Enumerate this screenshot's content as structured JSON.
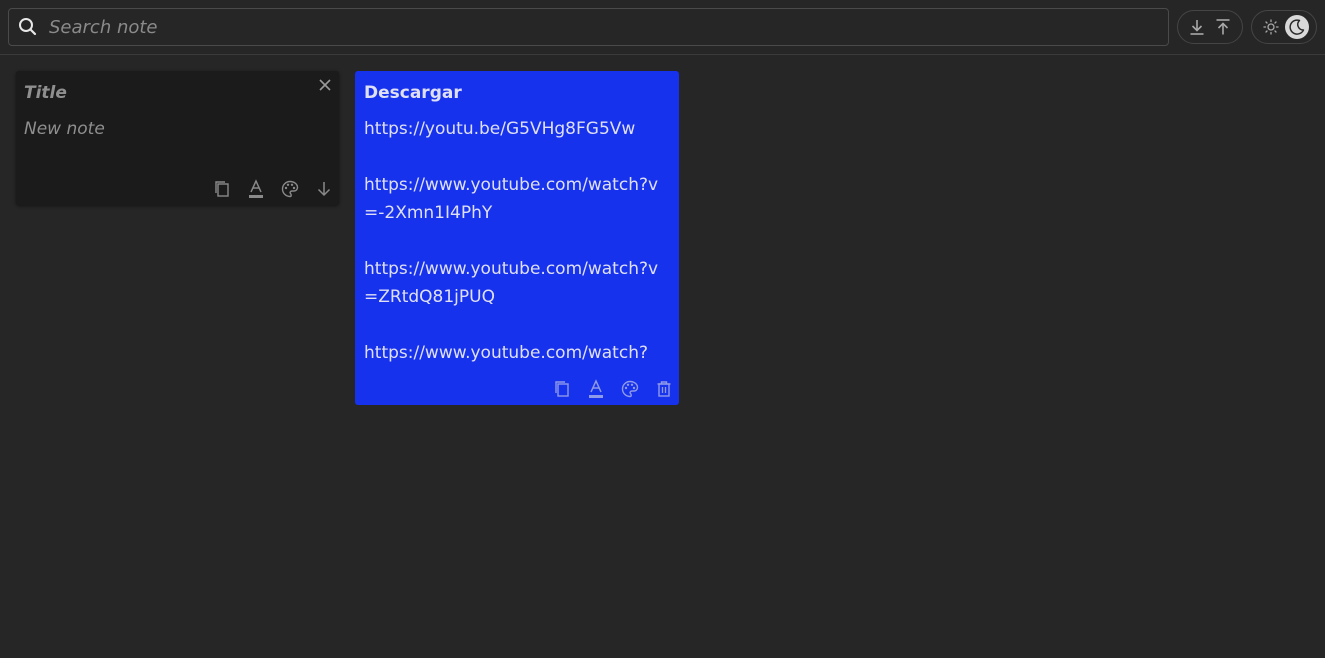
{
  "search": {
    "placeholder": "Search note",
    "value": ""
  },
  "header": {
    "io_buttons": [
      "download-icon",
      "upload-icon"
    ],
    "theme_toggle": {
      "light_icon": "sun-icon",
      "dark_icon": "moon-icon",
      "active": "dark"
    }
  },
  "new_note": {
    "title_placeholder": "Title",
    "body_placeholder": "New note",
    "toolbar": [
      "copy-icon",
      "text-color-icon",
      "palette-icon",
      "arrow-down-icon"
    ]
  },
  "notes": [
    {
      "title": "Descargar",
      "color": "#1732ed",
      "content": "https://youtu.be/G5VHg8FG5Vw\n\nhttps://www.youtube.com/watch?v=-2Xmn1I4PhY\n\nhttps://www.youtube.com/watch?v=ZRtdQ81jPUQ\n\nhttps://www.youtube.com/watch?",
      "toolbar": [
        "copy-icon",
        "text-color-icon",
        "palette-icon",
        "trash-icon"
      ]
    }
  ],
  "colors": {
    "background": "#262626",
    "note_dark": "#1b1b1b",
    "note_blue": "#1732ed"
  }
}
